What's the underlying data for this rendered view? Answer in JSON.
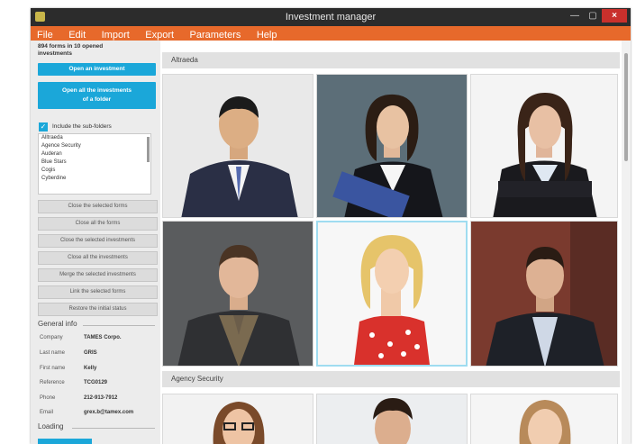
{
  "window": {
    "title": "Investment manager",
    "close_glyph": "×",
    "min_glyph": "—",
    "max_glyph": "▢"
  },
  "menu": [
    "File",
    "Edit",
    "Import",
    "Export",
    "Parameters",
    "Help"
  ],
  "sidebar": {
    "summary": "894 forms in 10 opened investments",
    "open_investment": "Open an investment",
    "open_all_folder": "Open all the investments of a folder",
    "include_subfolders": "Include the sub-folders",
    "list_items": [
      "Alltraeda",
      "Agence Security",
      "Auderan",
      "Blue Stars",
      "Cogis",
      "Cyberdine"
    ],
    "actions": [
      "Close the selected forms",
      "Close all the forms",
      "Close the selected investments",
      "Close all the investments",
      "Merge the selected investments",
      "Link the selected forms",
      "Restore the initial status"
    ],
    "general_info_title": "General info",
    "info": [
      {
        "label": "Company",
        "value": "TAMES Corpo."
      },
      {
        "label": "Last name",
        "value": "GRIS"
      },
      {
        "label": "First name",
        "value": "Kelly"
      },
      {
        "label": "Reference",
        "value": "TCG0129"
      },
      {
        "label": "Phone",
        "value": "212-913-7912"
      },
      {
        "label": "Email",
        "value": "grex.b@tamex.com"
      }
    ],
    "loading_title": "Loading"
  },
  "groups": [
    {
      "name": "Altraeda"
    },
    {
      "name": "Agency Security"
    }
  ],
  "colors": {
    "accent": "#1ba7d9",
    "menubar": "#e7692b",
    "titlebar": "#2c2c2c",
    "close": "#c9302c"
  }
}
